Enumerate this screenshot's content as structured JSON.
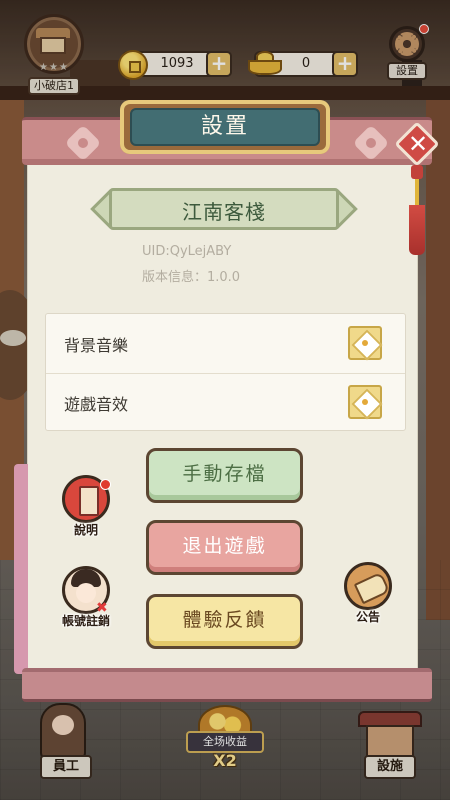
{
  "hud": {
    "shop_name": "小破店1",
    "shop_stars": "★★★",
    "coins": "1093",
    "ingots": "0",
    "settings_label": "設置"
  },
  "dialog": {
    "title": "設置",
    "inn_name": "江南客棧",
    "uid": "UID:QyLejABY",
    "version": "版本信息：1.0.0",
    "audio": [
      {
        "label": "背景音樂",
        "enabled": true
      },
      {
        "label": "遊戲音效",
        "enabled": true
      }
    ],
    "buttons": {
      "save": "手動存檔",
      "exit": "退出遊戲",
      "feedback": "體驗反饋"
    },
    "side": {
      "guide": "說明",
      "account": "帳號註銷",
      "notice": "公告"
    }
  },
  "bottom": {
    "staff": "員工",
    "income_label": "全场收益",
    "income_mult": "X2",
    "facility": "設施"
  },
  "colors": {
    "panel": "#efecdf",
    "title_plaque": "#426d72",
    "save_btn": "#cde4c3",
    "exit_btn": "#e8a5a0",
    "feedback_btn": "#f6e6a4",
    "close": "#cf4b45"
  }
}
